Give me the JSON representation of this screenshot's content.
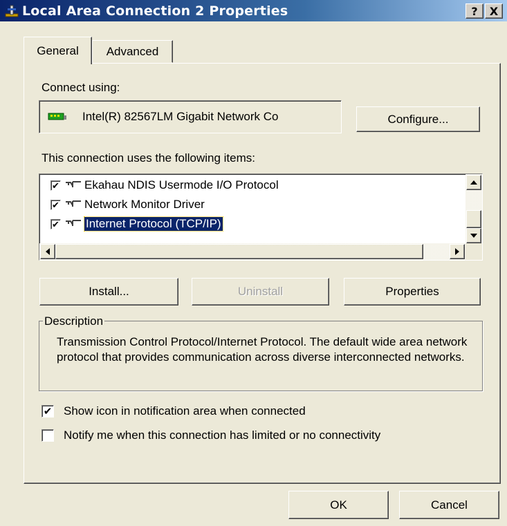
{
  "window": {
    "title": "Local Area Connection 2 Properties",
    "help_button": "?",
    "close_button": "X"
  },
  "tabs": [
    {
      "label": "General",
      "active": true
    },
    {
      "label": "Advanced",
      "active": false
    }
  ],
  "general": {
    "connect_using_label": "Connect using:",
    "adapter_name": "Intel(R) 82567LM Gigabit Network Co",
    "configure_button": "Configure...",
    "items_label": "This connection uses the following items:",
    "items": [
      {
        "label": "Ekahau NDIS Usermode I/O Protocol",
        "checked": true,
        "selected": false
      },
      {
        "label": "Network Monitor Driver",
        "checked": true,
        "selected": false
      },
      {
        "label": "Internet Protocol (TCP/IP)",
        "checked": true,
        "selected": true
      }
    ],
    "install_button": "Install...",
    "uninstall_button": "Uninstall",
    "properties_button": "Properties",
    "description_legend": "Description",
    "description_text": "Transmission Control Protocol/Internet Protocol. The default wide area network protocol that provides communication across diverse interconnected networks.",
    "show_icon_label": "Show icon in notification area when connected",
    "show_icon_checked": true,
    "notify_label": "Notify me when this connection has limited or no connectivity",
    "notify_checked": false
  },
  "footer": {
    "ok_button": "OK",
    "cancel_button": "Cancel"
  },
  "icons": {
    "title": "network-connection-icon",
    "adapter": "network-card-icon",
    "protocol": "network-protocol-icon"
  },
  "colors": {
    "titlebar_start": "#0a246a",
    "titlebar_end": "#a6caf0",
    "selection": "#0a246a",
    "dialog_bg": "#ece9d8"
  }
}
